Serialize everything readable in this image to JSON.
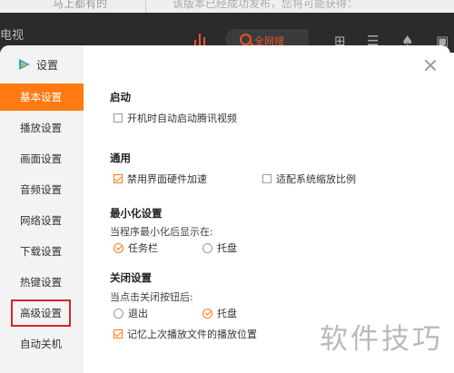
{
  "background": {
    "top_text_left": "马上都有的",
    "top_text_right": "该版本已经成功发布，您将可能获得：",
    "left_label": "电视",
    "search_label": "全网搜"
  },
  "dialog": {
    "title": "设置",
    "accent_color": "#ff7a12",
    "highlight_color": "#d9232d",
    "sidebar": [
      {
        "label": "基本设置",
        "active": true
      },
      {
        "label": "播放设置"
      },
      {
        "label": "画面设置"
      },
      {
        "label": "音频设置"
      },
      {
        "label": "网络设置"
      },
      {
        "label": "下载设置"
      },
      {
        "label": "热键设置"
      },
      {
        "label": "高级设置",
        "highlighted": true
      },
      {
        "label": "自动关机"
      }
    ],
    "startup": {
      "title": "启动",
      "auto_start": {
        "label": "开机时自动启动腾讯视频",
        "checked": false
      }
    },
    "general": {
      "title": "通用",
      "disable_hw_accel": {
        "label": "禁用界面硬件加速",
        "checked": true
      },
      "adapt_scaling": {
        "label": "适配系统缩放比例",
        "checked": false
      }
    },
    "minimize": {
      "title": "最小化设置",
      "prompt": "当程序最小化后显示在:",
      "options": [
        {
          "label": "任务栏",
          "selected": true
        },
        {
          "label": "托盘",
          "selected": false
        }
      ]
    },
    "close": {
      "title": "关闭设置",
      "prompt": "当点击关闭按钮后:",
      "options": [
        {
          "label": "退出",
          "selected": false
        },
        {
          "label": "托盘",
          "selected": true
        }
      ],
      "remember_position": {
        "label": "记忆上次播放文件的播放位置",
        "checked": true
      }
    }
  },
  "watermark": "软件技巧"
}
